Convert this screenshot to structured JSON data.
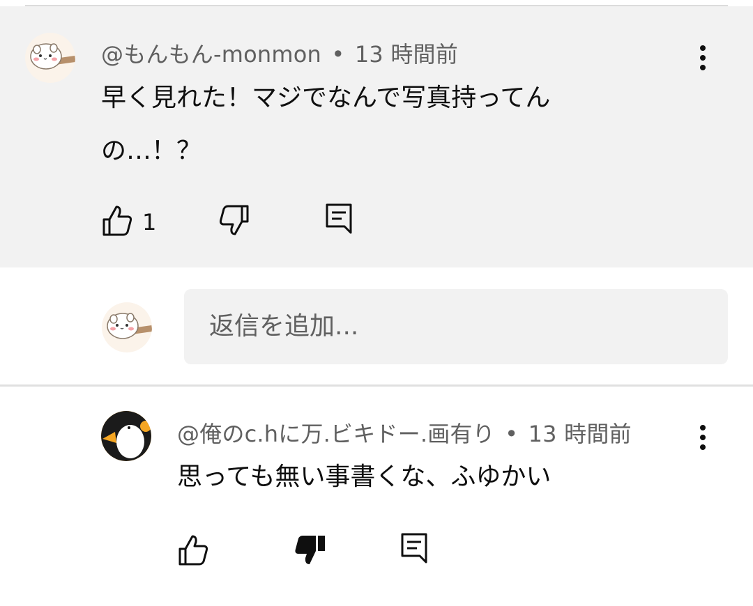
{
  "comment": {
    "author": "@もんもん-monmon",
    "separator": "•",
    "time": "13 時間前",
    "text_line1": "早く見れた！マジでなんで写真持ってん",
    "text_line2": "の…！？",
    "like_count": "1",
    "avatar_icon": "hamster-avatar-icon",
    "actions": [
      "like-icon",
      "dislike-icon",
      "reply-icon",
      "more-vert-icon"
    ]
  },
  "reply_box": {
    "placeholder": "返信を追加..."
  },
  "reply": {
    "author": "@俺のc.hに万.ビキドー.画有り",
    "separator": "•",
    "time": "13 時間前",
    "text": "思っても無い事書くな、ふゆかい",
    "disliked": true,
    "avatar_icon": "penguin-avatar-icon"
  },
  "colors": {
    "highlight_bg": "#f2f2f2",
    "secondary_text": "#606060",
    "primary_text": "#0f0f0f"
  }
}
